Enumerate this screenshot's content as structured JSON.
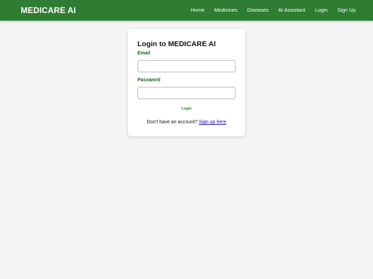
{
  "navbar": {
    "brand": "MEDICARE AI",
    "links": [
      "Home",
      "Medicines",
      "Diseases",
      "AI Assistant",
      "Login",
      "Sign Up"
    ],
    "background": "#2e7d32"
  },
  "login_card": {
    "title": "Login to MEDICARE AI",
    "email_label": "Email",
    "email_value": "",
    "password_label": "Password",
    "password_value": "",
    "submit_label": "Login",
    "signup_prompt": "Don't have an account?",
    "signup_link": "Sign up here"
  },
  "colors": {
    "accent": "#2e7d32",
    "label": "#1b5e20",
    "page_background": "#f5f5f5",
    "link": "#1a0dab"
  }
}
